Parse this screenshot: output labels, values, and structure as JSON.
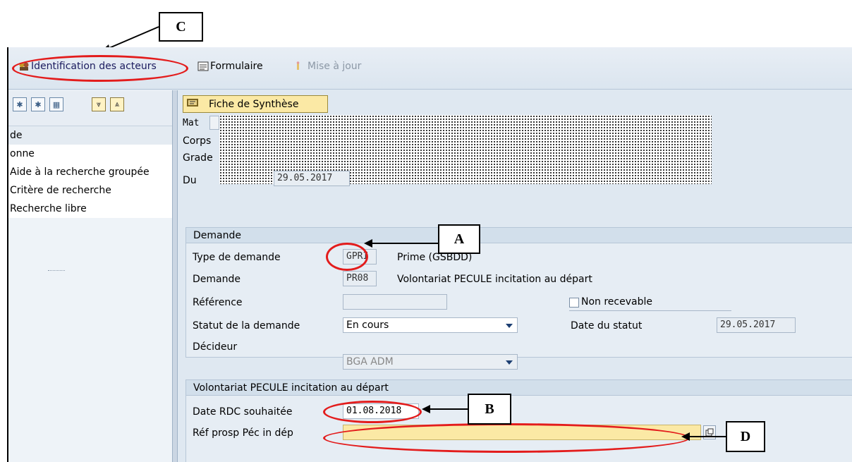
{
  "toolbar": {
    "identification_label": "Identification des acteurs",
    "formulaire_label": "Formulaire",
    "mise_a_jour_label": "Mise à jour"
  },
  "tree": {
    "items": [
      "de",
      "onne",
      "Aide à la recherche groupée",
      "Critère de recherche",
      "Recherche libre"
    ]
  },
  "header": {
    "fiche_button": "Fiche de Synthèse",
    "mat_label": "Mat",
    "corps_label": "Corps",
    "grade_label": "Grade",
    "du_label": "Du",
    "du_value": "29.05.2017"
  },
  "demande": {
    "title": "Demande",
    "type_label": "Type de demande",
    "type_code": "GPRI",
    "type_text": "Prime (GSBDD)",
    "demande_label": "Demande",
    "demande_code": "PR08",
    "demande_text": "Volontariat PECULE incitation au départ",
    "reference_label": "Référence",
    "reference_value": "",
    "non_recevable_label": "Non recevable",
    "statut_label": "Statut de la demande",
    "statut_value": "En cours",
    "date_statut_label": "Date du statut",
    "date_statut_value": "29.05.2017",
    "decideur_label": "Décideur",
    "decideur_value": "BGA ADM"
  },
  "volontariat": {
    "title": "Volontariat PECULE incitation au départ",
    "date_rdc_label": "Date RDC souhaitée",
    "date_rdc_value": "01.08.2018",
    "ref_prosp_label": "Réf prosp Péc in dép",
    "ref_prosp_value": ""
  },
  "annotations": {
    "a": "A",
    "b": "B",
    "c": "C",
    "d": "D"
  },
  "colors": {
    "highlight": "#e31c1c",
    "required_field": "#fbe9a5"
  }
}
